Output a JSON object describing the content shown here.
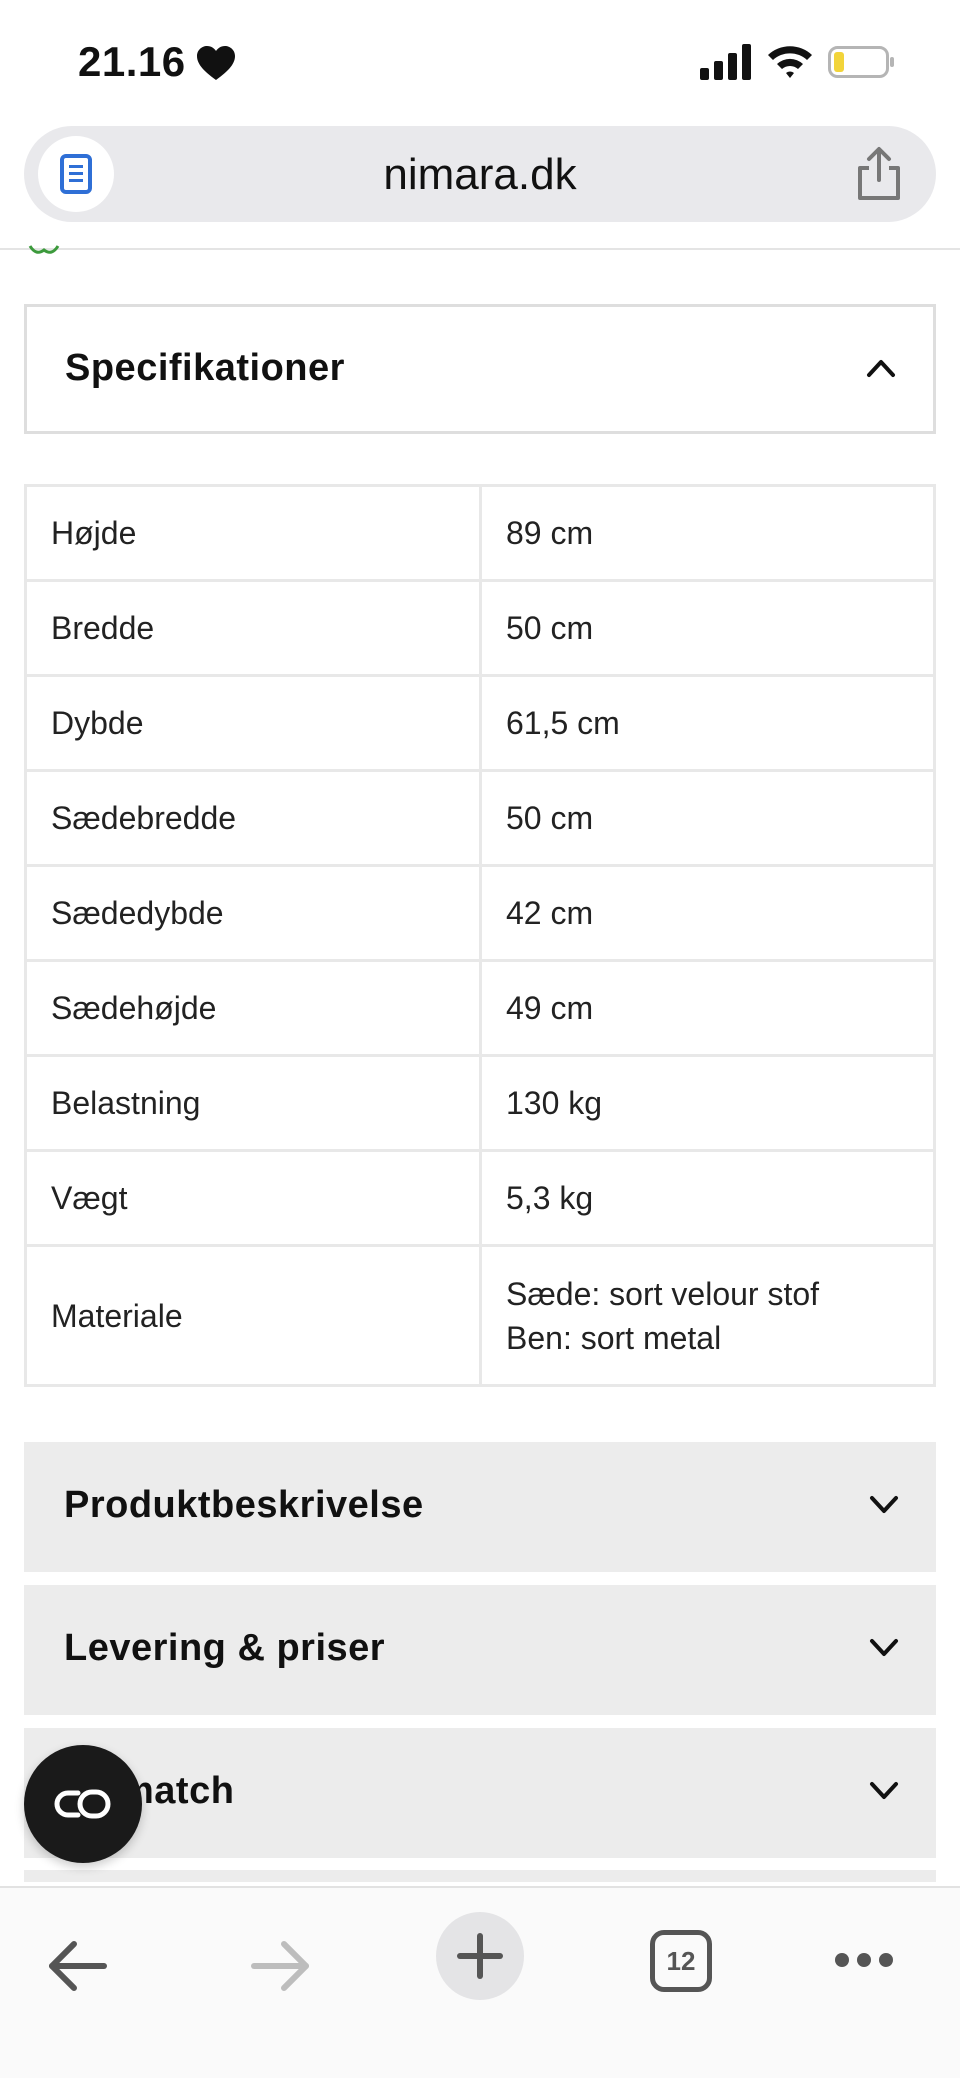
{
  "status_bar": {
    "time": "21.16"
  },
  "address_bar": {
    "url": "nimara.dk"
  },
  "specs": {
    "title": "Specifikationer",
    "rows": [
      {
        "label": "Højde",
        "value": "89 cm"
      },
      {
        "label": "Bredde",
        "value": "50 cm"
      },
      {
        "label": "Dybde",
        "value": "61,5 cm"
      },
      {
        "label": "Sædebredde",
        "value": "50 cm"
      },
      {
        "label": "Sædedybde",
        "value": "42 cm"
      },
      {
        "label": "Sædehøjde",
        "value": "49 cm"
      },
      {
        "label": "Belastning",
        "value": "130 kg"
      },
      {
        "label": "Vægt",
        "value": "5,3 kg"
      },
      {
        "label": "Materiale",
        "value_line1": "Sæde: sort velour stof",
        "value_line2": "Ben: sort metal"
      }
    ]
  },
  "accordions": [
    {
      "title": "Produktbeskrivelse"
    },
    {
      "title": "Levering & priser"
    },
    {
      "title": "match"
    }
  ],
  "toolbar": {
    "tab_count": "12"
  },
  "colors": {
    "accent_reader": "#2f6fd6",
    "battery_low": "#f2d43a",
    "fab": "#1a1a1a"
  }
}
